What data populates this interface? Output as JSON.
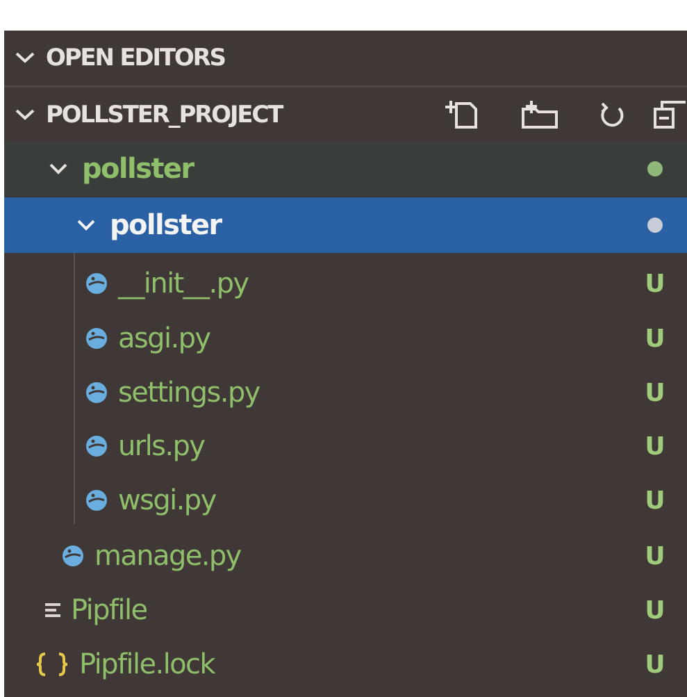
{
  "explorer": {
    "sections": {
      "open_editors": {
        "label": "OPEN EDITORS"
      },
      "project": {
        "label": "POLLSTER_PROJECT"
      }
    },
    "actions": [
      {
        "icon": "new-file-icon"
      },
      {
        "icon": "new-folder-icon"
      },
      {
        "icon": "refresh-icon"
      },
      {
        "icon": "collapse-all-icon"
      }
    ],
    "tree": {
      "root_folder": {
        "label": "pollster",
        "status_color": "#8fb87a"
      },
      "sub_folder": {
        "label": "pollster",
        "status_color": "#c8ccd6"
      },
      "files": [
        {
          "label": "__init__.py",
          "status": "U",
          "icon": "python-icon"
        },
        {
          "label": "asgi.py",
          "status": "U",
          "icon": "python-icon"
        },
        {
          "label": "settings.py",
          "status": "U",
          "icon": "python-icon"
        },
        {
          "label": "urls.py",
          "status": "U",
          "icon": "python-icon"
        },
        {
          "label": "wsgi.py",
          "status": "U",
          "icon": "python-icon"
        }
      ],
      "root_files": [
        {
          "label": "manage.py",
          "status": "U",
          "icon": "python-icon"
        },
        {
          "label": "Pipfile",
          "status": "U",
          "icon": "lines-icon"
        },
        {
          "label": "Pipfile.lock",
          "status": "U",
          "icon": "json-braces-icon"
        }
      ]
    },
    "colors": {
      "background": "#3f3836",
      "selection": "#2a61a4",
      "untracked_text": "#8fbf6a",
      "python_icon": "#6aaee0"
    }
  }
}
